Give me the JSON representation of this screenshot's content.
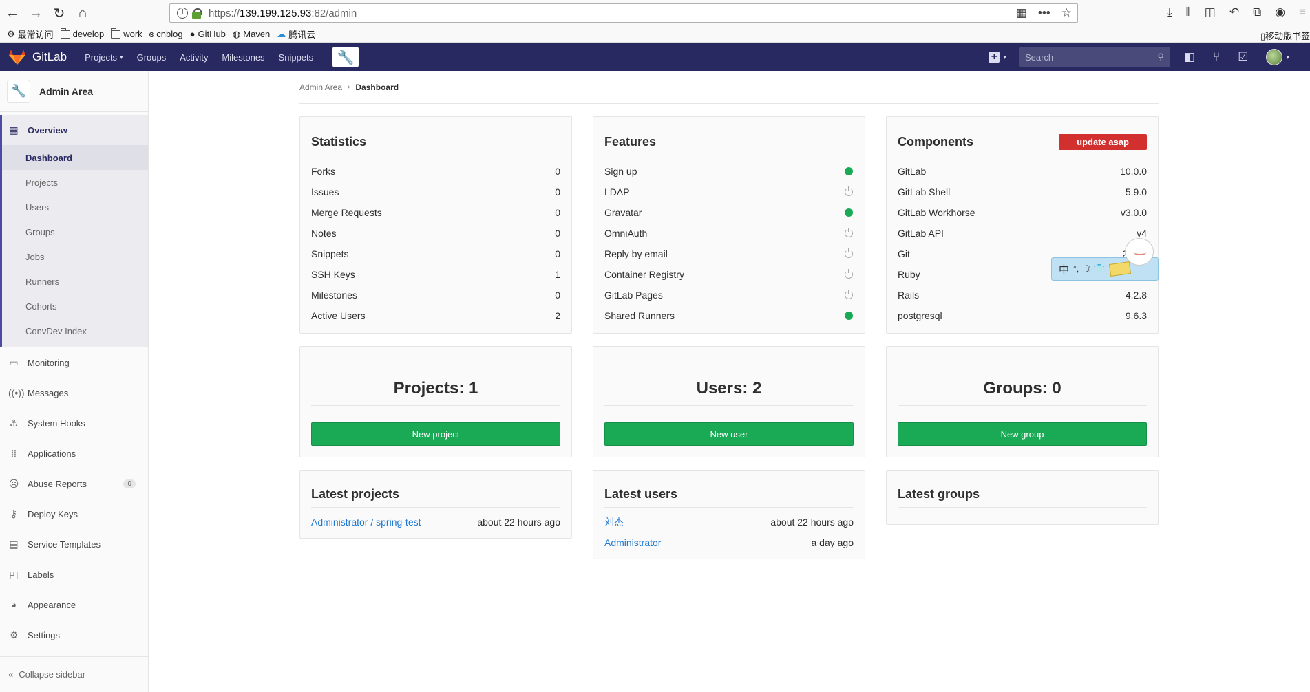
{
  "browser": {
    "url_prefix": "https://",
    "url_host": "139.199.125.93",
    "url_path": ":82/admin",
    "bookmarks": [
      {
        "label": "最常访问",
        "icon": "gear-icon"
      },
      {
        "label": "develop",
        "icon": "folder-icon"
      },
      {
        "label": "work",
        "icon": "folder-icon"
      },
      {
        "label": "cnblog",
        "icon": "cnblog-icon"
      },
      {
        "label": "GitHub",
        "icon": "github-icon"
      },
      {
        "label": "Maven",
        "icon": "maven-icon"
      },
      {
        "label": "腾讯云",
        "icon": "cloud-icon"
      }
    ],
    "mobile_bookmarks": "移动版书签"
  },
  "header": {
    "brand": "GitLab",
    "nav": {
      "projects": "Projects",
      "groups": "Groups",
      "activity": "Activity",
      "milestones": "Milestones",
      "snippets": "Snippets"
    },
    "search_placeholder": "Search"
  },
  "sidebar": {
    "context_title": "Admin Area",
    "overview": "Overview",
    "overview_items": [
      "Dashboard",
      "Projects",
      "Users",
      "Groups",
      "Jobs",
      "Runners",
      "Cohorts",
      "ConvDev Index"
    ],
    "items": {
      "monitoring": "Monitoring",
      "messages": "Messages",
      "system_hooks": "System Hooks",
      "applications": "Applications",
      "abuse_reports": "Abuse Reports",
      "abuse_reports_count": "0",
      "deploy_keys": "Deploy Keys",
      "service_templates": "Service Templates",
      "labels": "Labels",
      "appearance": "Appearance",
      "settings": "Settings"
    },
    "collapse": "Collapse sidebar"
  },
  "breadcrumb": {
    "parent": "Admin Area",
    "current": "Dashboard"
  },
  "statistics": {
    "title": "Statistics",
    "rows": [
      {
        "label": "Forks",
        "value": "0"
      },
      {
        "label": "Issues",
        "value": "0"
      },
      {
        "label": "Merge Requests",
        "value": "0"
      },
      {
        "label": "Notes",
        "value": "0"
      },
      {
        "label": "Snippets",
        "value": "0"
      },
      {
        "label": "SSH Keys",
        "value": "1"
      },
      {
        "label": "Milestones",
        "value": "0"
      },
      {
        "label": "Active Users",
        "value": "2"
      }
    ]
  },
  "features": {
    "title": "Features",
    "rows": [
      {
        "label": "Sign up",
        "enabled": true
      },
      {
        "label": "LDAP",
        "enabled": false
      },
      {
        "label": "Gravatar",
        "enabled": true
      },
      {
        "label": "OmniAuth",
        "enabled": false
      },
      {
        "label": "Reply by email",
        "enabled": false
      },
      {
        "label": "Container Registry",
        "enabled": false
      },
      {
        "label": "GitLab Pages",
        "enabled": false
      },
      {
        "label": "Shared Runners",
        "enabled": true
      }
    ]
  },
  "components": {
    "title": "Components",
    "update_badge": "update asap",
    "rows": [
      {
        "label": "GitLab",
        "value": "10.0.0"
      },
      {
        "label": "GitLab Shell",
        "value": "5.9.0"
      },
      {
        "label": "GitLab Workhorse",
        "value": "v3.0.0"
      },
      {
        "label": "GitLab API",
        "value": "v4"
      },
      {
        "label": "Git",
        "value": "2"
      },
      {
        "label": "Ruby",
        "value": ""
      },
      {
        "label": "Rails",
        "value": "4.2.8"
      },
      {
        "label": "postgresql",
        "value": "9.6.3"
      }
    ]
  },
  "counts": {
    "projects_title": "Projects: 1",
    "projects_button": "New project",
    "users_title": "Users: 2",
    "users_button": "New user",
    "groups_title": "Groups: 0",
    "groups_button": "New group"
  },
  "latest_projects": {
    "title": "Latest projects",
    "rows": [
      {
        "name": "Administrator / spring-test",
        "time": "about 22 hours ago"
      }
    ]
  },
  "latest_users": {
    "title": "Latest users",
    "rows": [
      {
        "name": "刘杰",
        "time": "about 22 hours ago"
      },
      {
        "name": "Administrator",
        "time": "a day ago"
      }
    ]
  },
  "latest_groups": {
    "title": "Latest groups"
  },
  "ime": {
    "label": "中"
  },
  "colors": {
    "header_bg": "#292961",
    "green": "#1aaa55",
    "danger": "#d22f2f",
    "link": "#1f78d1"
  }
}
